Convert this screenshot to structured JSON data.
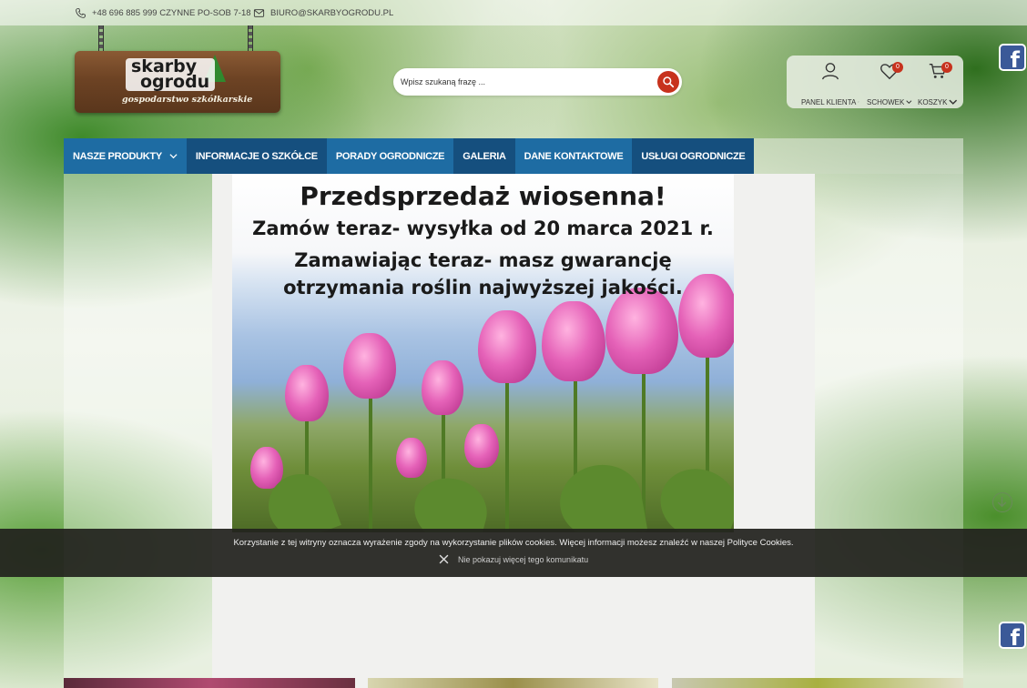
{
  "topbar": {
    "phone": "+48 696 885 999 CZYNNE PO-SOB 7-18",
    "email": "BIURO@SKARBYOGRODU.PL"
  },
  "logo": {
    "name_line1": "skarby",
    "name_line2": "ogrodu",
    "tagline": "gospodarstwo szkółkarskie"
  },
  "search": {
    "placeholder": "Wpisz szukaną frazę ..."
  },
  "account": {
    "panel_label": "PANEL KLIENTA",
    "wishlist_label": "SCHOWEK",
    "wishlist_count": "0",
    "cart_label": "KOSZYK",
    "cart_count": "0"
  },
  "nav": {
    "items": [
      {
        "label": "NASZE PRODUKTY"
      },
      {
        "label": "INFORMACJE O SZKÓŁCE"
      },
      {
        "label": "PORADY OGRODNICZE"
      },
      {
        "label": "GALERIA"
      },
      {
        "label": "DANE KONTAKTOWE"
      },
      {
        "label": "USŁUGI OGRODNICZE"
      }
    ]
  },
  "banner": {
    "title": "Przedsprzedaż wiosenna!",
    "line2": "Zamów teraz- wysyłka od 20 marca 2021 r.",
    "line3": "Zamawiając teraz- masz gwarancję otrzymania roślin najwyższej jakości."
  },
  "cookie": {
    "message": "Korzystanie z tej witryny oznacza wyrażenie zgody na wykorzystanie plików cookies. Więcej informacji możesz znaleźć w naszej Polityce Cookies.",
    "dismiss": "Nie pokazuj więcej tego komunikatu"
  },
  "colors": {
    "nav_blue": "#1e6ca3",
    "nav_dark": "#154f7e",
    "accent_red": "#c7321d",
    "facebook": "#3b5998"
  }
}
